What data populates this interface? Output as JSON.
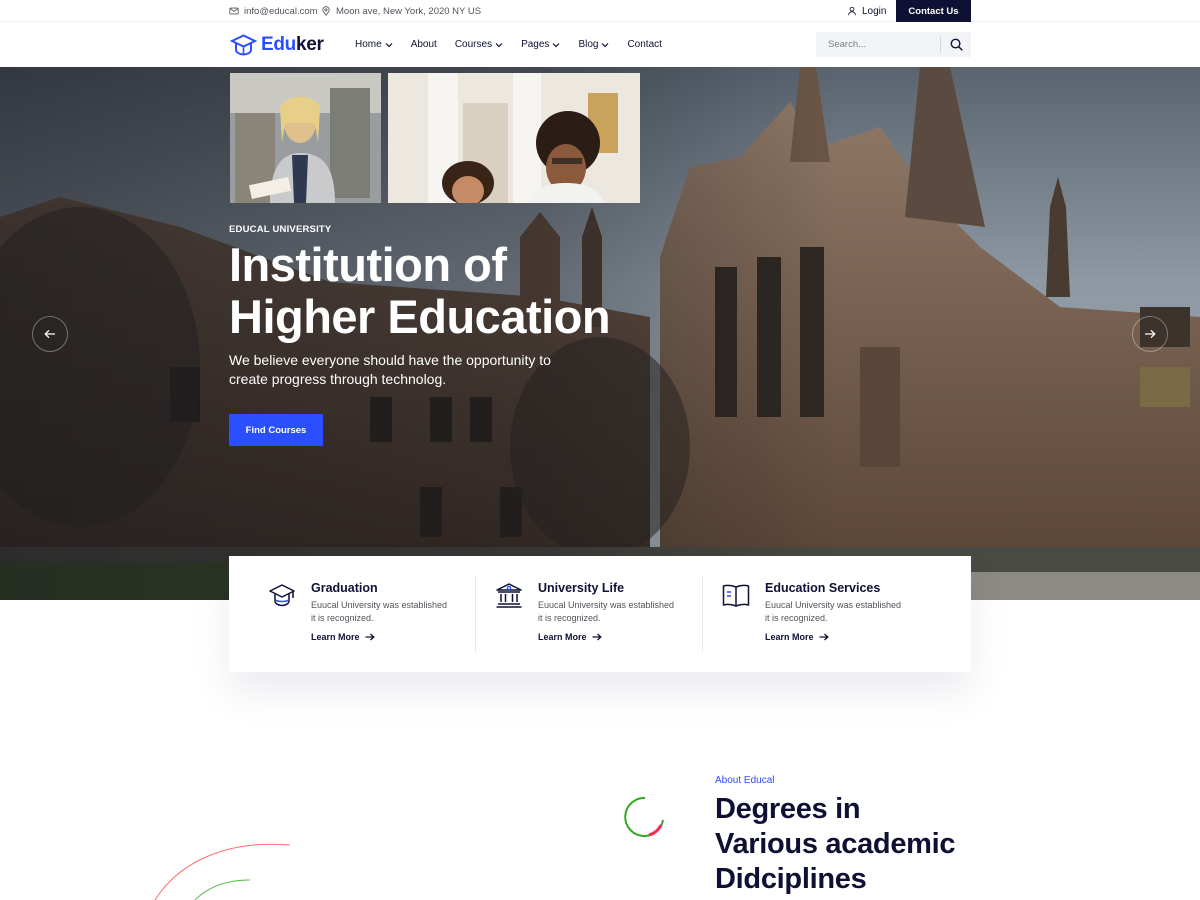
{
  "topbar": {
    "email": "info@educal.com",
    "address": "Moon ave, New York, 2020 NY US",
    "login": "Login",
    "contact_button": "Contact Us"
  },
  "header": {
    "logo_blue": "Edu",
    "logo_dark": "ker",
    "nav": [
      {
        "label": "Home",
        "has_dropdown": true
      },
      {
        "label": "About",
        "has_dropdown": false
      },
      {
        "label": "Courses",
        "has_dropdown": true
      },
      {
        "label": "Pages",
        "has_dropdown": true
      },
      {
        "label": "Blog",
        "has_dropdown": true
      },
      {
        "label": "Contact",
        "has_dropdown": false
      }
    ],
    "search_placeholder": "Search..."
  },
  "hero": {
    "kicker": "EDUCAL UNIVERSITY",
    "title_line1": "Institution of",
    "title_line2": "Higher Education",
    "subtitle": "We believe everyone should have the opportunity to create progress through technolog.",
    "cta": "Find Courses"
  },
  "features": [
    {
      "icon": "graduation-cap-icon",
      "title": "Graduation",
      "desc_line1": "Euucal University was established",
      "desc_line2": "it is recognized.",
      "link": "Learn More"
    },
    {
      "icon": "university-building-icon",
      "title": "University Life",
      "desc_line1": "Euucal University was established",
      "desc_line2": "it is recognized.",
      "link": "Learn More"
    },
    {
      "icon": "book-icon",
      "title": "Education Services",
      "desc_line1": "Euucal University was established",
      "desc_line2": "it is recognized.",
      "link": "Learn More"
    }
  ],
  "about": {
    "kicker": "About Educal",
    "title_line1": "Degrees in",
    "title_line2": "Various academic",
    "title_line3": "Didciplines"
  },
  "colors": {
    "accent": "#2b4eff",
    "dark": "#0e1133",
    "text_muted": "#53545b"
  }
}
